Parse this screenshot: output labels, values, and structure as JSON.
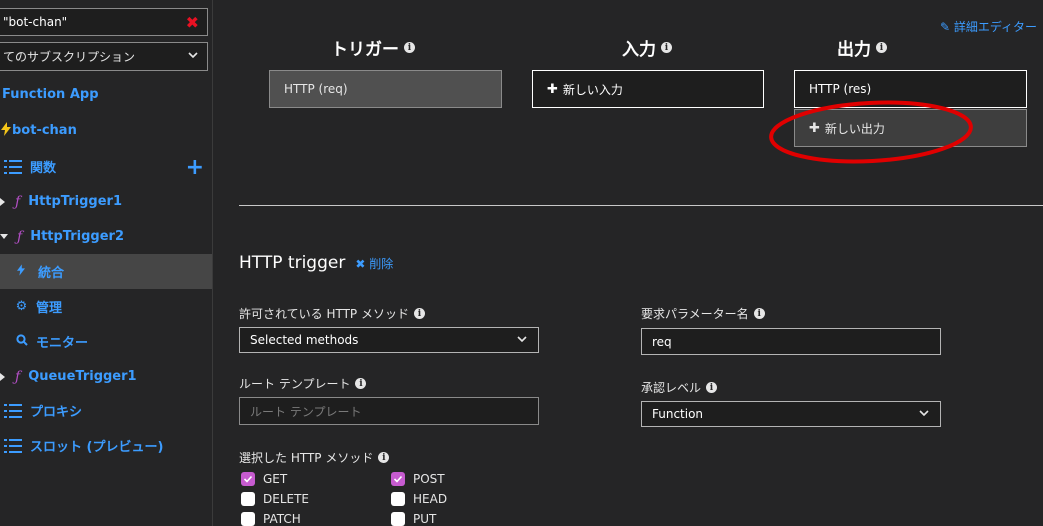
{
  "sidebar": {
    "search_value": "\"bot-chan\"",
    "subscription_value": "てのサブスクリプション",
    "items": [
      {
        "label": "Function App"
      },
      {
        "label": "bot-chan"
      },
      {
        "label": "関数"
      },
      {
        "label": "HttpTrigger1"
      },
      {
        "label": "HttpTrigger2"
      },
      {
        "label": "統合"
      },
      {
        "label": "管理"
      },
      {
        "label": "モニター"
      },
      {
        "label": "QueueTrigger1"
      },
      {
        "label": "プロキシ"
      },
      {
        "label": "スロット (プレビュー)"
      }
    ]
  },
  "main": {
    "advanced_editor": "詳細エディター",
    "columns": {
      "trigger_title": "トリガー",
      "input_title": "入力",
      "output_title": "出力",
      "trigger_box": "HTTP (req)",
      "new_input": "新しい入力",
      "output_box": "HTTP (res)",
      "new_output": "新しい出力"
    },
    "section": {
      "title": "HTTP trigger",
      "delete": "削除",
      "methods_label": "許可されている HTTP メソッド",
      "methods_value": "Selected methods",
      "param_label": "要求パラメーター名",
      "param_value": "req",
      "route_label": "ルート テンプレート",
      "route_placeholder": "ルート テンプレート",
      "auth_label": "承認レベル",
      "auth_value": "Function",
      "selected_methods_label": "選択した HTTP メソッド",
      "methods": [
        {
          "name": "GET",
          "checked": true
        },
        {
          "name": "POST",
          "checked": true
        },
        {
          "name": "DELETE",
          "checked": false
        },
        {
          "name": "HEAD",
          "checked": false
        },
        {
          "name": "PATCH",
          "checked": false
        },
        {
          "name": "PUT",
          "checked": false
        }
      ]
    }
  },
  "colors": {
    "accent": "#3c9cff",
    "annotation": "#e00000",
    "checkbox": "#c75bd0"
  }
}
